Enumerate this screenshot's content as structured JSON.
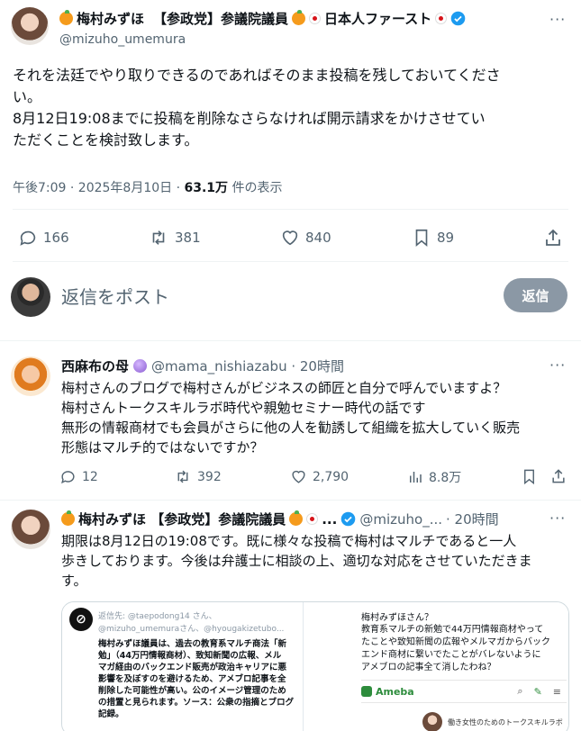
{
  "main_post": {
    "display_name_1": "梅村みずほ",
    "display_name_2": "【参政党】参議院議員",
    "display_name_3": "日本人ファースト",
    "handle": "@mizuho_umemura",
    "text_lines": [
      "それを法廷でやり取りできるのであればそのまま投稿を残しておいてくださ",
      "い。",
      "8月12日19:08までに投稿を削除なさらなければ開示請求をかけさせてい",
      "ただくことを検討致します。"
    ],
    "time": "午後7:09 · 2025年8月10日 · ",
    "views_count": "63.1万",
    "views_label": "件の表示",
    "replies": "166",
    "reposts": "381",
    "likes": "840",
    "bookmarks": "89"
  },
  "composer": {
    "placeholder": "返信をポスト",
    "button_label": "返信"
  },
  "reply_1": {
    "display_name": "西麻布の母",
    "handle_time": "@mama_nishiazabu · 20時間",
    "text_lines": [
      "梅村さんのブログで梅村さんがビジネスの師匠と自分で呼んでいますよ？",
      "梅村さんトークスキルラボ時代や親勉セミナー時代の話です",
      "無形の情報商材でも会員がさらに他の人を勧誘して組織を拡大していく販売",
      "形態はマルチ的ではないですか？"
    ],
    "replies": "12",
    "reposts": "392",
    "likes": "2,790",
    "views": "8.8万"
  },
  "reply_2": {
    "display_name": "梅村みずほ 【参政党】参議院議員",
    "ellipsis": "...",
    "handle": "@mizuho_...",
    "time": "· 20時間",
    "text_lines": [
      "期限は8月12日の19:08です。既に様々な投稿で梅村はマルチであると一人",
      "歩きしております。今後は弁護士に相談の上、適切な対応をさせていただきま",
      "す。"
    ],
    "embed_left": {
      "header": "返信先: @taepodong14 さん、",
      "header2": "@mizuho_umemuraさん、@hyougakizetubo...",
      "body_lines": [
        "梅村みずほ議員は、過去の教育系マルチ商法「新",
        "勉」（44万円情報商材）、致知新聞の広報、メル",
        "マガ経由のバックエンド販売が政治キャリアに悪",
        "影響を及ぼすのを避けるため、アメブロ記事を全",
        "削除した可能性が高い。公のイメージ管理のため",
        "の措置と見られます。ソース：公衆の指摘とブログ",
        "記録。"
      ]
    },
    "embed_right": {
      "header": "梅村みずほさん？",
      "body_lines": [
        "教育系マルチの新勉で44万円情報商材やって",
        "たことや致知新聞の広報やメルマガからバック",
        "エンド商材に繋いでたことがバレないように",
        "アメブロの記事全て消したわね？"
      ],
      "app_name": "Ameba",
      "footer": "働き女性のためのトークスキルラボ"
    }
  }
}
